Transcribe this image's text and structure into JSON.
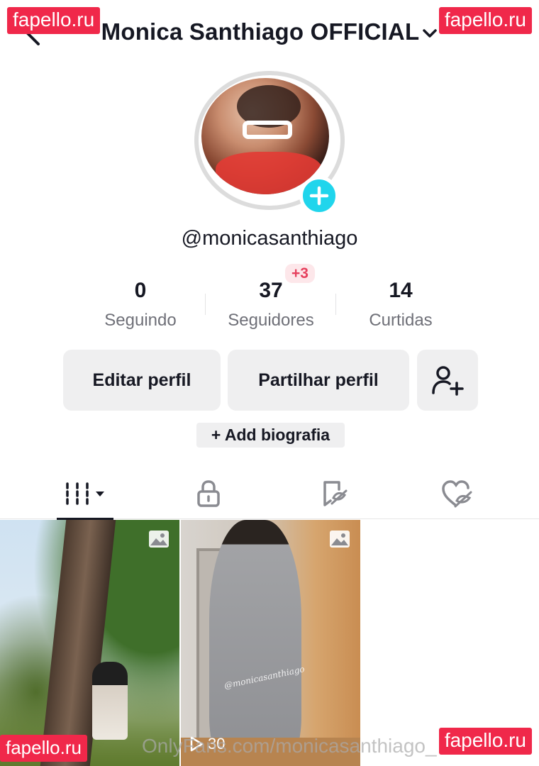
{
  "header": {
    "title": "Monica Santhiago OFFICIAL",
    "back_icon": "back-arrow-icon",
    "chevron_icon": "chevron-down-icon"
  },
  "watermarks": {
    "top_left": "fapello.ru",
    "top_right": "fapello.ru",
    "bottom_left": "fapello.ru",
    "bottom_right": "fapello.ru",
    "footer": "OnlyFans.com/monicasanthiago_"
  },
  "profile": {
    "username": "@monicasanthiago",
    "add_icon": "plus-icon"
  },
  "stats": {
    "following": {
      "value": "0",
      "label": "Seguindo"
    },
    "followers": {
      "value": "37",
      "label": "Seguidores",
      "badge": "+3"
    },
    "likes": {
      "value": "14",
      "label": "Curtidas"
    }
  },
  "actions": {
    "edit_label": "Editar perfil",
    "share_label": "Partilhar perfil",
    "add_friend_icon": "add-user-icon",
    "bio_label": "+ Add biografia"
  },
  "tabs": [
    {
      "name": "videos",
      "icon": "grid-icon"
    },
    {
      "name": "private",
      "icon": "lock-icon"
    },
    {
      "name": "reposts",
      "icon": "repost-icon"
    },
    {
      "name": "liked",
      "icon": "heart-hidden-icon"
    }
  ],
  "grid": {
    "items": [
      {
        "type": "photo",
        "icon": "photo-icon"
      },
      {
        "type": "photo",
        "icon": "photo-icon",
        "caption": "@monicasanthiago",
        "play_count": "30"
      }
    ]
  },
  "colors": {
    "accent": "#20d5ec",
    "badge_bg": "#fde7ea",
    "badge_text": "#e6405d",
    "watermark": "#f0284a",
    "button_bg": "#efeff0"
  }
}
